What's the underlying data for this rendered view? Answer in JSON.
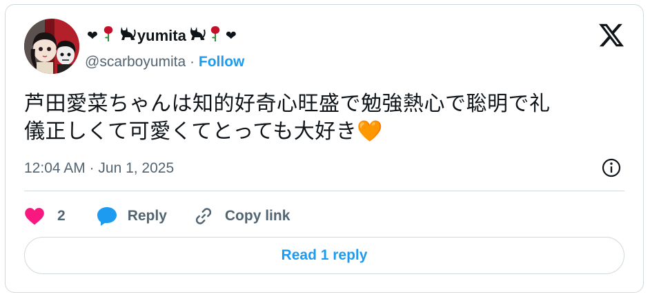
{
  "author": {
    "display_name": {
      "prefix_emoji": [
        "heart",
        "rose",
        "cat"
      ],
      "name": "yumita",
      "suffix_emoji": [
        "cat",
        "rose",
        "heart"
      ]
    },
    "handle": "@scarboyumita",
    "separator": "·",
    "follow_label": "Follow",
    "avatar_icon": "avatar-photo"
  },
  "platform_icon": "x-logo-icon",
  "tweet": {
    "text_lines": [
      "芦田愛菜ちゃんは知的好奇心旺盛で勉強熱心で聡明で礼",
      "儀正しくて可愛くてとっても大好き"
    ],
    "trailing_emoji": "🧡",
    "timestamp": "12:04 AM · Jun 1, 2025"
  },
  "actions": {
    "like_count": "2",
    "reply_label": "Reply",
    "copy_link_label": "Copy link"
  },
  "read_reply_label": "Read 1 reply",
  "colors": {
    "accent": "#1d9bf0",
    "like": "#f91880",
    "muted": "#536471",
    "border": "#cfd9de",
    "orange_heart": "#f4900c"
  }
}
